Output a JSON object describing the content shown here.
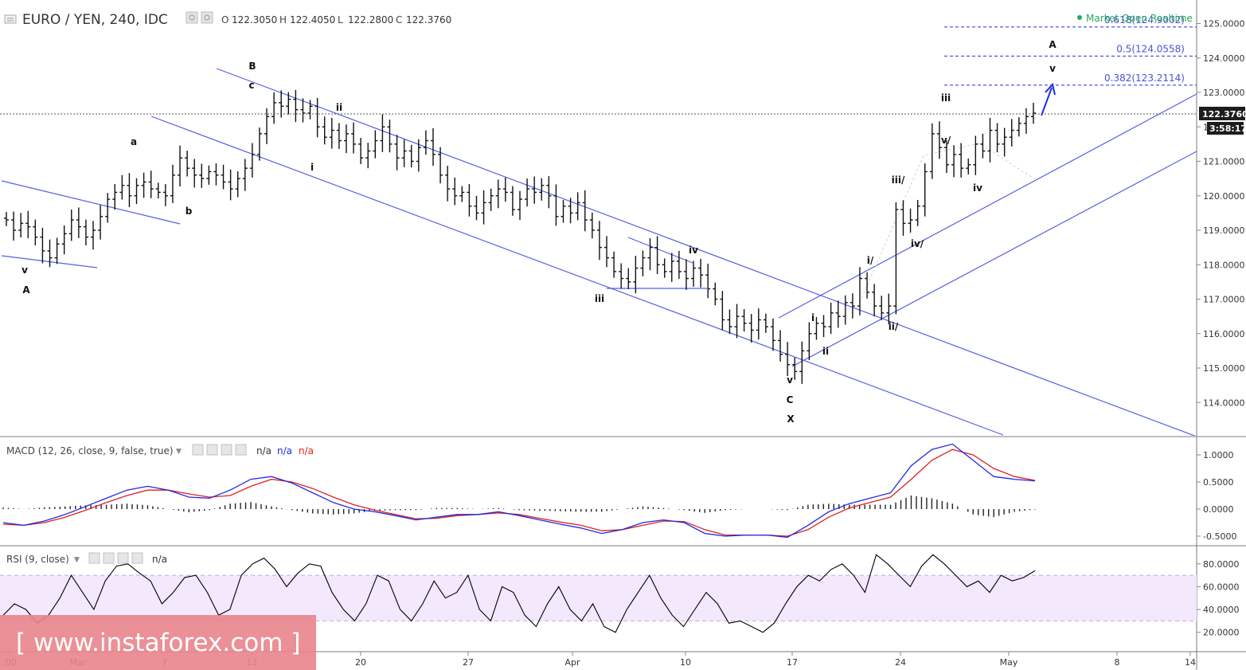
{
  "header": {
    "symbol": "EURO / YEN, 240, IDC",
    "ohlc": [
      {
        "key": "O",
        "value": "122.3050"
      },
      {
        "key": "H",
        "value": "122.4050"
      },
      {
        "key": "L",
        "value": "122.2800"
      },
      {
        "key": "C",
        "value": "122.3760"
      }
    ],
    "market_status": "Market Open Realtime",
    "status_color": "#26a65b"
  },
  "price_tag": {
    "price": "122.3760",
    "countdown": "3:58:17"
  },
  "watermark": "[ www.instaforex.com ]",
  "colors": {
    "line": "#5561e6",
    "macd": "#1f2bdf",
    "signal": "#e02121",
    "rsi_band": "#f3e8fc",
    "rsi_band_line": "#c9a9e0",
    "fib": "#2430d8"
  },
  "chart_data": [
    {
      "type": "ohlc",
      "panel": "price",
      "y_axis_ticks": [
        "113.0000",
        "114.0000",
        "115.0000",
        "116.0000",
        "117.0000",
        "118.0000",
        "119.0000",
        "120.0000",
        "121.0000",
        "122.0000",
        "123.0000",
        "124.0000",
        "125.0000"
      ],
      "ylim": [
        112.95,
        125.45
      ],
      "x_axis_ticks": [
        ":00",
        "Mar",
        "7",
        "13",
        "20",
        "27",
        "Apr",
        "10",
        "17",
        "24",
        "May",
        "8",
        "14"
      ],
      "bar_closes": [
        119.3,
        119.0,
        119.2,
        119.1,
        118.8,
        118.4,
        118.2,
        118.6,
        118.9,
        119.3,
        119.1,
        118.8,
        119.0,
        119.4,
        119.9,
        120.1,
        120.3,
        120.0,
        120.3,
        120.4,
        120.2,
        120.1,
        120.0,
        120.6,
        121.1,
        120.8,
        120.6,
        120.5,
        120.7,
        120.6,
        120.4,
        120.2,
        120.5,
        120.8,
        121.2,
        121.8,
        122.3,
        122.7,
        122.6,
        122.8,
        122.5,
        122.4,
        122.6,
        122.0,
        121.7,
        121.9,
        121.6,
        121.8,
        121.5,
        121.1,
        121.3,
        121.6,
        122.0,
        121.5,
        121.1,
        121.3,
        121.0,
        121.4,
        121.6,
        121.2,
        120.6,
        120.2,
        120.0,
        120.1,
        119.7,
        119.5,
        119.8,
        120.0,
        120.2,
        120.1,
        119.6,
        119.9,
        120.2,
        120.1,
        120.3,
        120.0,
        119.4,
        119.7,
        119.5,
        119.8,
        119.3,
        119.0,
        118.5,
        118.2,
        117.8,
        117.6,
        117.5,
        117.9,
        118.2,
        118.5,
        118.0,
        117.8,
        118.1,
        117.8,
        117.6,
        117.9,
        117.7,
        117.3,
        117.0,
        116.4,
        116.2,
        116.5,
        116.3,
        116.1,
        116.4,
        116.2,
        115.8,
        115.4,
        115.1,
        114.9,
        115.5,
        116.0,
        116.3,
        116.2,
        116.6,
        116.5,
        116.9,
        116.8,
        117.6,
        117.2,
        116.8,
        116.6,
        116.8,
        119.6,
        119.2,
        119.3,
        119.7,
        120.7,
        121.8,
        121.4,
        120.9,
        121.2,
        120.8,
        120.9,
        121.5,
        121.3,
        121.9,
        121.5,
        121.7,
        121.9,
        122.1,
        122.3,
        122.4
      ],
      "fib_levels": [
        {
          "label": "0.618(124.9002)",
          "value": 124.9002
        },
        {
          "label": "0.5(124.0558)",
          "value": 124.0558
        },
        {
          "label": "0.382(123.2114)",
          "value": 123.2114
        }
      ],
      "last_price": 122.376,
      "wave_labels": [
        "v",
        "A",
        "a",
        "b",
        "B",
        "c",
        "i",
        "ii",
        "iii",
        "iv",
        "v",
        "C",
        "X",
        "i",
        "ii",
        "i/",
        "ii/",
        "iii/",
        "iv/",
        "v/",
        "iii",
        "iv",
        "A",
        "v"
      ]
    },
    {
      "type": "line",
      "panel": "macd",
      "title": "MACD (12, 26, close, 9, false, true)",
      "na_labels": [
        "n/a",
        "n/a",
        "n/a"
      ],
      "y_axis_ticks": [
        "1.0000",
        "0.5000",
        "0.0000",
        "-0.5000"
      ],
      "ylim": [
        -0.65,
        1.35
      ],
      "series": [
        {
          "name": "MACD",
          "values": [
            -0.25,
            -0.3,
            -0.22,
            -0.1,
            0.05,
            0.2,
            0.35,
            0.42,
            0.35,
            0.22,
            0.2,
            0.35,
            0.55,
            0.6,
            0.48,
            0.3,
            0.12,
            0.0,
            -0.05,
            -0.12,
            -0.2,
            -0.15,
            -0.1,
            -0.1,
            -0.05,
            -0.12,
            -0.2,
            -0.28,
            -0.35,
            -0.45,
            -0.38,
            -0.25,
            -0.2,
            -0.25,
            -0.45,
            -0.5,
            -0.48,
            -0.48,
            -0.52,
            -0.3,
            -0.05,
            0.1,
            0.2,
            0.3,
            0.8,
            1.1,
            1.2,
            0.9,
            0.6,
            0.55,
            0.52
          ]
        },
        {
          "name": "Signal",
          "values": [
            -0.28,
            -0.3,
            -0.25,
            -0.15,
            -0.02,
            0.12,
            0.25,
            0.35,
            0.35,
            0.28,
            0.22,
            0.25,
            0.42,
            0.55,
            0.5,
            0.38,
            0.22,
            0.08,
            -0.02,
            -0.1,
            -0.18,
            -0.17,
            -0.12,
            -0.1,
            -0.07,
            -0.1,
            -0.17,
            -0.24,
            -0.3,
            -0.4,
            -0.38,
            -0.3,
            -0.22,
            -0.23,
            -0.38,
            -0.48,
            -0.48,
            -0.48,
            -0.5,
            -0.38,
            -0.15,
            0.02,
            0.12,
            0.22,
            0.55,
            0.9,
            1.1,
            1.0,
            0.75,
            0.6,
            0.53
          ]
        },
        {
          "name": "Histogram",
          "values": [
            0.03,
            0.0,
            0.03,
            0.05,
            0.07,
            0.08,
            0.1,
            0.07,
            0.0,
            -0.06,
            -0.02,
            0.1,
            0.13,
            0.05,
            -0.02,
            -0.08,
            -0.1,
            -0.08,
            -0.03,
            -0.02,
            -0.02,
            0.02,
            0.02,
            0.0,
            0.02,
            -0.02,
            -0.03,
            -0.04,
            -0.05,
            -0.05,
            0.0,
            0.05,
            0.02,
            -0.02,
            -0.07,
            -0.02,
            0.0,
            0.0,
            -0.02,
            0.08,
            0.1,
            0.08,
            0.08,
            0.08,
            0.25,
            0.2,
            0.1,
            -0.1,
            -0.15,
            -0.05,
            -0.01
          ]
        }
      ]
    },
    {
      "type": "line",
      "panel": "rsi",
      "title": "RSI (9, close)",
      "na_label": "n/a",
      "y_axis_ticks": [
        "80.0000",
        "60.0000",
        "40.0000",
        "20.0000"
      ],
      "ylim": [
        10,
        92
      ],
      "band": [
        30,
        70
      ],
      "series": [
        {
          "name": "RSI",
          "values": [
            35,
            45,
            40,
            28,
            35,
            50,
            70,
            55,
            40,
            65,
            78,
            80,
            72,
            65,
            45,
            55,
            68,
            70,
            55,
            35,
            40,
            70,
            80,
            85,
            75,
            60,
            72,
            80,
            78,
            55,
            40,
            30,
            45,
            70,
            65,
            40,
            30,
            45,
            65,
            50,
            55,
            70,
            40,
            30,
            60,
            55,
            35,
            25,
            45,
            60,
            40,
            30,
            45,
            25,
            20,
            40,
            55,
            70,
            50,
            35,
            25,
            40,
            55,
            45,
            28,
            30,
            25,
            20,
            28,
            45,
            60,
            70,
            65,
            75,
            80,
            70,
            55,
            88,
            80,
            70,
            60,
            78,
            88,
            80,
            70,
            60,
            65,
            55,
            70,
            65,
            68,
            74
          ]
        }
      ]
    }
  ]
}
